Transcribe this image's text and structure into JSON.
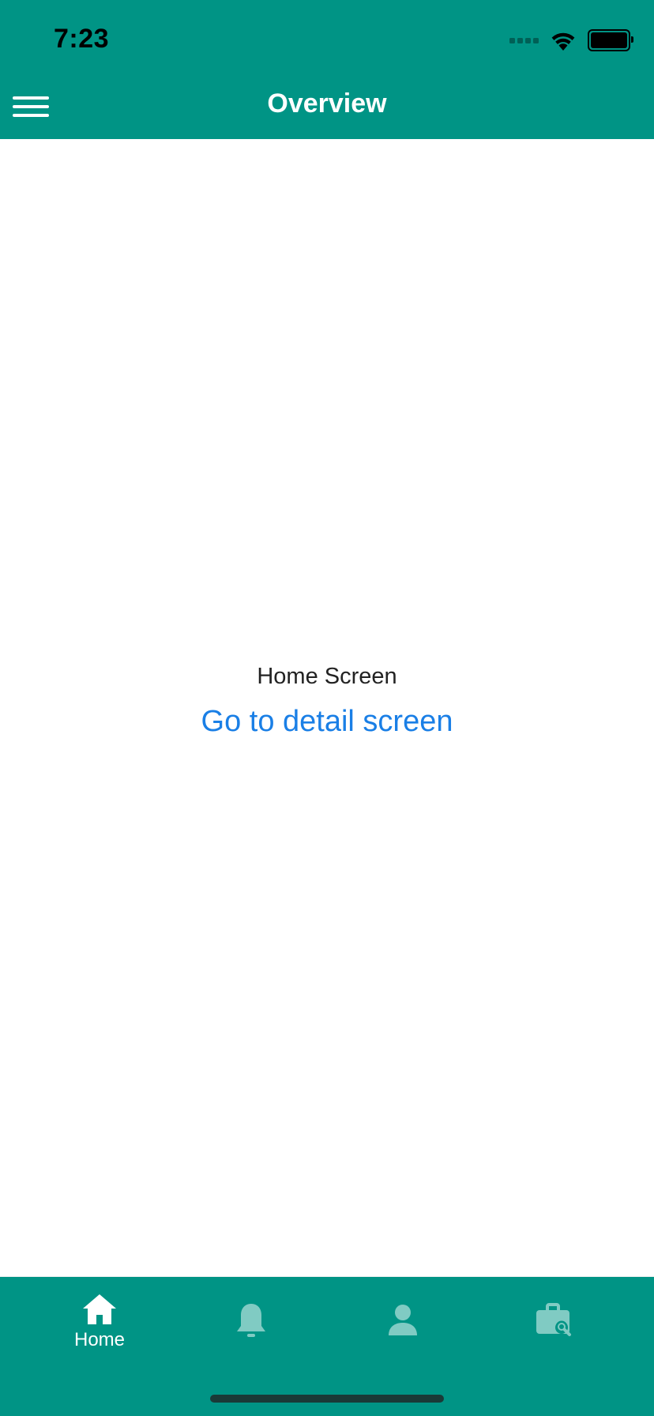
{
  "status_bar": {
    "time": "7:23",
    "icons": [
      "cellular-signal-icon",
      "wifi-icon",
      "battery-icon"
    ]
  },
  "header": {
    "title": "Overview",
    "menu_icon": "hamburger-menu-icon"
  },
  "main": {
    "label": "Home Screen",
    "link": "Go to detail screen"
  },
  "tab_bar": {
    "tabs": [
      {
        "icon": "home-icon",
        "label": "Home",
        "active": true
      },
      {
        "icon": "bell-icon",
        "label": "",
        "active": false
      },
      {
        "icon": "person-icon",
        "label": "",
        "active": false
      },
      {
        "icon": "briefcase-search-icon",
        "label": "",
        "active": false
      }
    ]
  },
  "colors": {
    "primary": "#009485",
    "active_icon": "#ffffff",
    "inactive_icon": "#80cbc3",
    "link": "#1a7fe6"
  }
}
